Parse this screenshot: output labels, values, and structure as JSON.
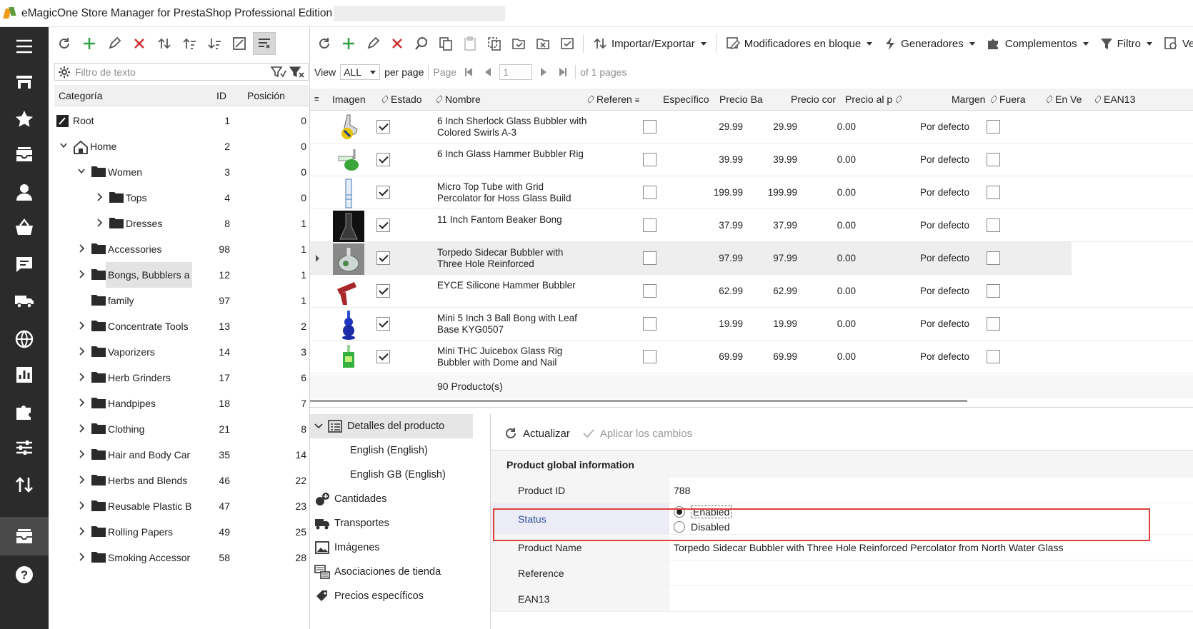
{
  "window": {
    "title": "eMagicOne Store Manager for PrestaShop Professional Edition"
  },
  "nav_icons": [
    "menu-icon",
    "store-icon",
    "star-icon",
    "inbox-icon",
    "user-icon",
    "basket-icon",
    "chat-icon",
    "truck-icon",
    "globe-icon",
    "chart-icon",
    "puzzle-icon",
    "sliders-icon",
    "import-export-icon",
    "products-icon",
    "help-icon"
  ],
  "category_panel": {
    "filter_placeholder": "Filtro de texto",
    "columns": {
      "category": "Categoría",
      "id": "ID",
      "position": "Posición"
    },
    "rows": [
      {
        "name": "Root",
        "id": "1",
        "pos": "0",
        "level": 0,
        "expand": "none",
        "icon": "root"
      },
      {
        "name": "Home",
        "id": "2",
        "pos": "0",
        "level": 0,
        "expand": "open",
        "icon": "home"
      },
      {
        "name": "Women",
        "id": "3",
        "pos": "0",
        "level": 1,
        "expand": "open",
        "icon": "folder"
      },
      {
        "name": "Tops",
        "id": "4",
        "pos": "0",
        "level": 2,
        "expand": "closed",
        "icon": "folder"
      },
      {
        "name": "Dresses",
        "id": "8",
        "pos": "1",
        "level": 2,
        "expand": "closed",
        "icon": "folder"
      },
      {
        "name": "Accessories",
        "id": "98",
        "pos": "1",
        "level": 1,
        "expand": "closed",
        "icon": "folder"
      },
      {
        "name": "Bongs, Bubblers a",
        "id": "12",
        "pos": "1",
        "level": 1,
        "expand": "closed",
        "icon": "folder",
        "selected": true
      },
      {
        "name": "family",
        "id": "97",
        "pos": "1",
        "level": 1,
        "expand": "none",
        "icon": "folder"
      },
      {
        "name": "Concentrate Tools",
        "id": "13",
        "pos": "2",
        "level": 1,
        "expand": "closed",
        "icon": "folder"
      },
      {
        "name": "Vaporizers",
        "id": "14",
        "pos": "3",
        "level": 1,
        "expand": "closed",
        "icon": "folder"
      },
      {
        "name": "Herb Grinders",
        "id": "17",
        "pos": "6",
        "level": 1,
        "expand": "closed",
        "icon": "folder"
      },
      {
        "name": "Handpipes",
        "id": "18",
        "pos": "7",
        "level": 1,
        "expand": "closed",
        "icon": "folder"
      },
      {
        "name": "Clothing",
        "id": "21",
        "pos": "8",
        "level": 1,
        "expand": "closed",
        "icon": "folder"
      },
      {
        "name": "Hair and Body Car",
        "id": "35",
        "pos": "14",
        "level": 1,
        "expand": "closed",
        "icon": "folder"
      },
      {
        "name": "Herbs and Blends",
        "id": "46",
        "pos": "22",
        "level": 1,
        "expand": "closed",
        "icon": "folder"
      },
      {
        "name": "Reusable Plastic B",
        "id": "47",
        "pos": "23",
        "level": 1,
        "expand": "closed",
        "icon": "folder"
      },
      {
        "name": "Rolling Papers",
        "id": "49",
        "pos": "25",
        "level": 1,
        "expand": "closed",
        "icon": "folder"
      },
      {
        "name": "Smoking Accessor",
        "id": "58",
        "pos": "28",
        "level": 1,
        "expand": "closed",
        "icon": "folder"
      }
    ]
  },
  "main_toolbar": {
    "import_export": "Importar/Exportar",
    "bulk_modifiers": "Modificadores en bloque",
    "generators": "Generadores",
    "addons": "Complementos",
    "filter": "Filtro",
    "view": "Ver"
  },
  "pager": {
    "view_label": "View",
    "view_value": "ALL",
    "per_page": "per page",
    "page_label": "Page",
    "page_value": "1",
    "of_pages": "of 1 pages"
  },
  "grid": {
    "columns": {
      "image": "Imagen",
      "status": "Estado",
      "name": "Nombre",
      "reference": "Referen",
      "specific": "Específico",
      "base_price": "Precio Ba",
      "price_with": "Precio cor",
      "price_wholesale": "Precio al p",
      "margin": "Margen",
      "out_of_stock": "Fuera",
      "on_sale": "En Ve",
      "ean13": "EAN13"
    },
    "rows": [
      {
        "name": "6 Inch Sherlock Glass Bubbler with Colored Swirls A-3",
        "status": true,
        "base": "29.99",
        "price": "29.99",
        "wholesale": "0.00",
        "oos": "Por defecto",
        "thumb": "sherlock"
      },
      {
        "name": "6 Inch Glass Hammer Bubbler Rig",
        "status": true,
        "base": "39.99",
        "price": "39.99",
        "wholesale": "0.00",
        "oos": "Por defecto",
        "thumb": "hammer"
      },
      {
        "name": "Micro Top Tube with Grid Percolator for Hoss Glass Build",
        "status": true,
        "base": "199.99",
        "price": "199.99",
        "wholesale": "0.00",
        "oos": "Por defecto",
        "thumb": "tube"
      },
      {
        "name": "11 Inch Fantom Beaker Bong",
        "status": true,
        "base": "37.99",
        "price": "37.99",
        "wholesale": "0.00",
        "oos": "Por defecto",
        "thumb": "beaker"
      },
      {
        "name": "Torpedo Sidecar Bubbler with Three Hole Reinforced",
        "status": true,
        "base": "97.99",
        "price": "97.99",
        "wholesale": "0.00",
        "oos": "Por defecto",
        "thumb": "torpedo",
        "selected": true
      },
      {
        "name": "EYCE Silicone Hammer Bubbler",
        "status": true,
        "base": "62.99",
        "price": "62.99",
        "wholesale": "0.00",
        "oos": "Por defecto",
        "thumb": "eyce"
      },
      {
        "name": "Mini 5 Inch 3 Ball Bong with Leaf Base  KYG0507",
        "status": true,
        "base": "19.99",
        "price": "19.99",
        "wholesale": "0.00",
        "oos": "Por defecto",
        "thumb": "ball"
      },
      {
        "name": "Mini THC Juicebox Glass Rig Bubbler with Dome and Nail",
        "status": true,
        "base": "69.99",
        "price": "69.99",
        "wholesale": "0.00",
        "oos": "Por defecto",
        "thumb": "juicebox"
      }
    ],
    "footer": "90 Producto(s)"
  },
  "detail_tree": {
    "items": [
      {
        "label": "Detalles del producto",
        "icon": "details-icon",
        "indent": 0,
        "expand": "open",
        "selected": true
      },
      {
        "label": "English (English)",
        "icon": "",
        "indent": 1,
        "expand": "none"
      },
      {
        "label": "English GB (English)",
        "icon": "",
        "indent": 1,
        "expand": "none"
      },
      {
        "label": "Cantidades",
        "icon": "quantity-icon",
        "indent": 0,
        "expand": "none"
      },
      {
        "label": "Transportes",
        "icon": "truck-icon",
        "indent": 0,
        "expand": "none"
      },
      {
        "label": "Imágenes",
        "icon": "image-icon",
        "indent": 0,
        "expand": "none"
      },
      {
        "label": "Asociaciones de tienda",
        "icon": "shop-assoc-icon",
        "indent": 0,
        "expand": "none"
      },
      {
        "label": "Precios específicos",
        "icon": "tag-icon",
        "indent": 0,
        "expand": "none"
      }
    ]
  },
  "detail_form": {
    "refresh": "Actualizar",
    "apply": "Aplicar los cambios",
    "section_title": "Product global information",
    "fields": {
      "product_id_label": "Product ID",
      "product_id_value": "788",
      "status_label": "Status",
      "status_enabled": "Enabled",
      "status_disabled": "Disabled",
      "status_value": "Enabled",
      "name_label": "Product Name",
      "name_value": "Torpedo Sidecar Bubbler with Three Hole Reinforced Percolator from North Water Glass",
      "reference_label": "Reference",
      "reference_value": "",
      "ean13_label": "EAN13",
      "ean13_value": ""
    }
  },
  "colors": {
    "nav_bg": "#2b2b2b",
    "add_green": "#2ea043",
    "delete_red": "#d03030",
    "highlight_red": "#e0403a",
    "status_label_blue": "#2c4f9a"
  }
}
